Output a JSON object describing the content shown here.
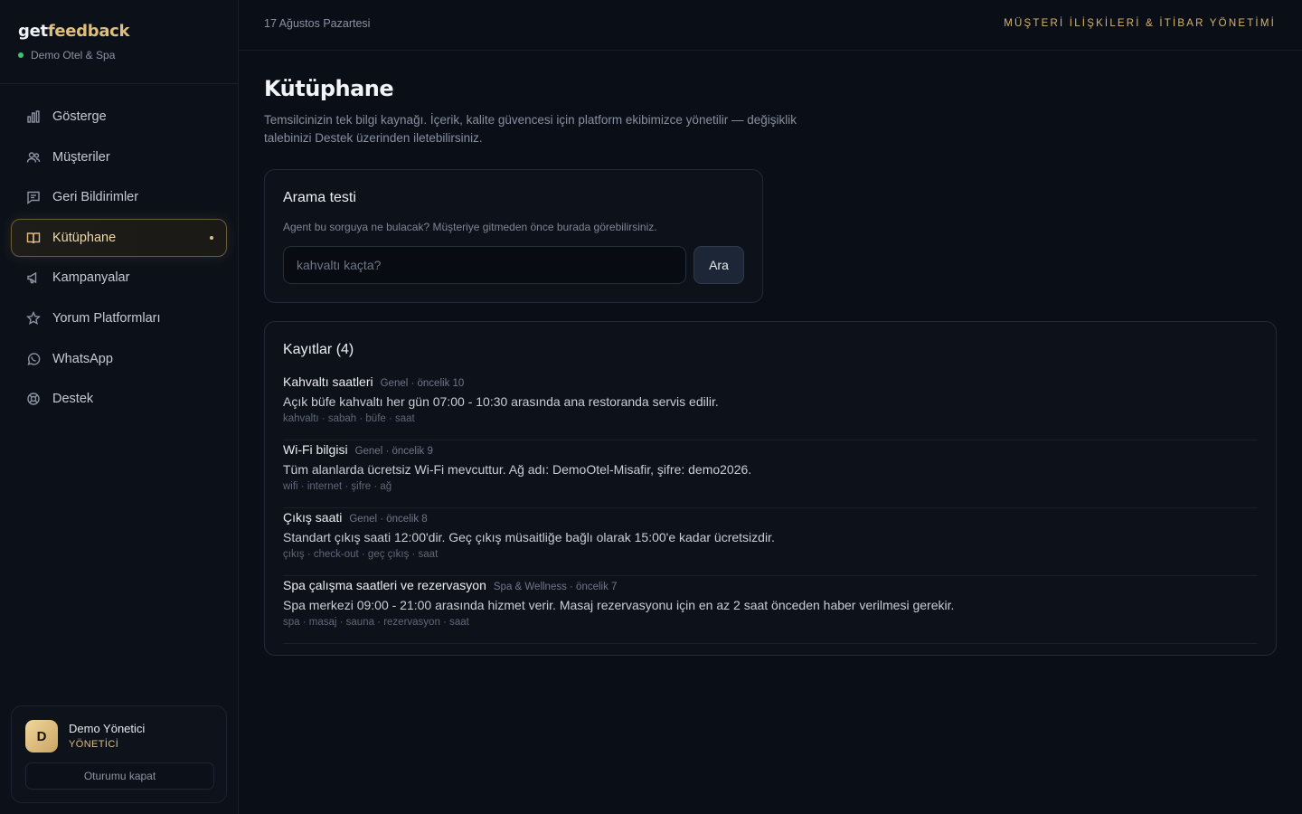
{
  "brand": {
    "logo_part1": "get",
    "logo_part2": "feedback",
    "org_name": "Demo Otel & Spa"
  },
  "sidebar": {
    "items": [
      {
        "label": "Gösterge",
        "icon": "chart-bars-icon"
      },
      {
        "label": "Müşteriler",
        "icon": "users-icon"
      },
      {
        "label": "Geri Bildirimler",
        "icon": "message-icon"
      },
      {
        "label": "Kütüphane",
        "icon": "book-icon",
        "active": true
      },
      {
        "label": "Kampanyalar",
        "icon": "megaphone-icon"
      },
      {
        "label": "Yorum Platformları",
        "icon": "star-icon"
      },
      {
        "label": "WhatsApp",
        "icon": "whatsapp-icon"
      },
      {
        "label": "Destek",
        "icon": "lifebuoy-icon"
      }
    ]
  },
  "user": {
    "initial": "D",
    "name": "Demo Yönetici",
    "role": "YÖNETİCİ",
    "logout_label": "Oturumu kapat"
  },
  "header": {
    "date": "17 Ağustos Pazartesi",
    "tagline": "MÜŞTERİ İLİŞKİLERİ & İTİBAR YÖNETİMİ"
  },
  "page": {
    "title": "Kütüphane",
    "description": "Temsilcinizin tek bilgi kaynağı. İçerik, kalite güvencesi için platform ekibimizce yönetilir — değişiklik talebinizi Destek üzerinden iletebilirsiniz."
  },
  "search_test": {
    "title": "Arama testi",
    "hint": "Agent bu sorguya ne bulacak? Müşteriye gitmeden önce burada görebilirsiniz.",
    "placeholder": "kahvaltı kaçta?",
    "button_label": "Ara"
  },
  "records": {
    "title": "Kayıtlar (4)",
    "items": [
      {
        "title": "Kahvaltı saatleri",
        "meta": "Genel · öncelik 10",
        "body": "Açık büfe kahvaltı her gün 07:00 - 10:30 arasında ana restoranda servis edilir.",
        "tags": "kahvaltı · sabah · büfe · saat"
      },
      {
        "title": "Wi-Fi bilgisi",
        "meta": "Genel · öncelik 9",
        "body": "Tüm alanlarda ücretsiz Wi-Fi mevcuttur. Ağ adı: DemoOtel-Misafir, şifre: demo2026.",
        "tags": "wifi · internet · şifre · ağ"
      },
      {
        "title": "Çıkış saati",
        "meta": "Genel · öncelik 8",
        "body": "Standart çıkış saati 12:00'dir. Geç çıkış müsaitliğe bağlı olarak 15:00'e kadar ücretsizdir.",
        "tags": "çıkış · check-out · geç çıkış · saat"
      },
      {
        "title": "Spa çalışma saatleri ve rezervasyon",
        "meta": "Spa & Wellness · öncelik 7",
        "body": "Spa merkezi 09:00 - 21:00 arasında hizmet verir. Masaj rezervasyonu için en az 2 saat önceden haber verilmesi gerekir.",
        "tags": "spa · masaj · sauna · rezervasyon · saat"
      }
    ]
  },
  "colors": {
    "accent": "#e0bf7e",
    "status_online": "#3ec46d",
    "background": "#0a0e16"
  }
}
